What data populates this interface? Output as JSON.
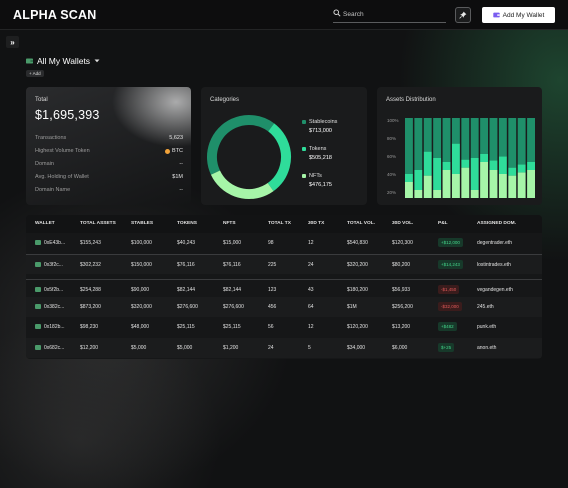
{
  "app": {
    "logo": "ALPHA SCAN"
  },
  "header": {
    "search_placeholder": "Search",
    "add_wallet_label": "Add My Wallet"
  },
  "wallets": {
    "title": "All My Wallets",
    "add_label": "+ Add"
  },
  "total_card": {
    "label": "Total",
    "amount": "$1,695,393",
    "rows": [
      {
        "label": "Transactions",
        "value": "5,623"
      },
      {
        "label": "Highest Volume Token",
        "value": "BTC"
      },
      {
        "label": "Domain",
        "value": "--"
      },
      {
        "label": "Avg. Holding of Wallet",
        "value": "$1M"
      },
      {
        "label": "Domain Name",
        "value": "--"
      }
    ]
  },
  "categories_card": {
    "title": "Categories",
    "items": [
      {
        "name": "Stablecoins",
        "value": "$713,000",
        "color": "#1f8f6a",
        "amount": 713000
      },
      {
        "name": "Tokens",
        "value": "$505,218",
        "color": "#2fdc9a",
        "amount": 505218
      },
      {
        "name": "NFTs",
        "value": "$476,175",
        "color": "#a6f5a8",
        "amount": 476175
      }
    ]
  },
  "chart_data": {
    "type": "bar",
    "stacked": true,
    "title": "Assets Distribution",
    "y_ticks": [
      "100%",
      "80%",
      "60%",
      "40%",
      "20%",
      "0%"
    ],
    "ylim": [
      0,
      100
    ],
    "series": [
      {
        "color": "#a6f5a8",
        "values": [
          20,
          10,
          28,
          10,
          35,
          30,
          38,
          10,
          45,
          35,
          30,
          28,
          32,
          35
        ]
      },
      {
        "color": "#2fdc9a",
        "values": [
          10,
          25,
          30,
          40,
          10,
          38,
          10,
          40,
          10,
          12,
          22,
          10,
          10,
          10
        ]
      },
      {
        "color": "#1f8f6a",
        "values": [
          70,
          65,
          42,
          50,
          55,
          32,
          52,
          50,
          45,
          53,
          48,
          62,
          58,
          55
        ]
      }
    ]
  },
  "table": {
    "headers": [
      "WALLET",
      "TOTAL ASSETS",
      "STABLES",
      "TOKENS",
      "NFTS",
      "TOTAL TX",
      "30D TX",
      "TOTAL VOL.",
      "30D VOL.",
      "P&L",
      "ASSIGNED DOM."
    ],
    "rows": [
      {
        "wallet": "0xE43b...",
        "total": "$155,243",
        "stables": "$100,000",
        "tokens": "$40,243",
        "nfts": "$15,000",
        "tx": "98",
        "tx30": "12",
        "vol": "$540,830",
        "vol30": "$120,300",
        "pnl": "+$12,000",
        "pnl_type": "pos",
        "domain": "degentrader.eth"
      },
      {
        "wallet": "0x3f2c...",
        "total": "$302,232",
        "stables": "$150,000",
        "tokens": "$76,116",
        "nfts": "$76,116",
        "tx": "225",
        "tx30": "24",
        "vol": "$320,200",
        "vol30": "$80,200",
        "pnl": "+$14,243",
        "pnl_type": "pos",
        "domain": "lostintrades.eth"
      },
      {
        "wallet": "0x5f2b...",
        "total": "$254,288",
        "stables": "$90,000",
        "tokens": "$82,144",
        "nfts": "$82,144",
        "tx": "123",
        "tx30": "43",
        "vol": "$180,200",
        "vol30": "$56,933",
        "pnl": "-$1,450",
        "pnl_type": "neg",
        "domain": "vegandegen.eth"
      },
      {
        "wallet": "0x382c...",
        "total": "$873,200",
        "stables": "$320,000",
        "tokens": "$276,600",
        "nfts": "$276,600",
        "tx": "456",
        "tx30": "64",
        "vol": "$1M",
        "vol30": "$256,200",
        "pnl": "-$32,000",
        "pnl_type": "neg",
        "domain": "245.eth"
      },
      {
        "wallet": "0x182b...",
        "total": "$98,230",
        "stables": "$48,000",
        "tokens": "$25,115",
        "nfts": "$25,115",
        "tx": "56",
        "tx30": "12",
        "vol": "$120,200",
        "vol30": "$13,200",
        "pnl": "+$482",
        "pnl_type": "pos",
        "domain": "punk.eth"
      },
      {
        "wallet": "0x682c...",
        "total": "$12,200",
        "stables": "$5,000",
        "tokens": "$5,000",
        "nfts": "$1,200",
        "tx": "24",
        "tx30": "5",
        "vol": "$34,000",
        "vol30": "$6,000",
        "pnl": "$+25",
        "pnl_type": "pos",
        "domain": "anon.eth"
      }
    ]
  }
}
